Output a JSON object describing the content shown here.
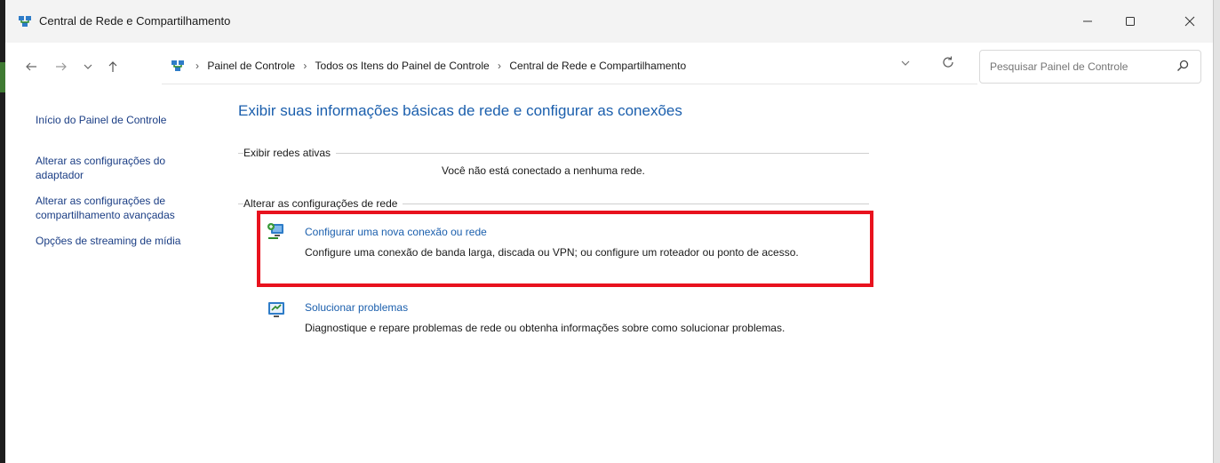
{
  "window": {
    "title": "Central de Rede e Compartilhamento"
  },
  "navigation": {
    "breadcrumbs": [
      "Painel de Controle",
      "Todos os Itens do Painel de Controle",
      "Central de Rede e Compartilhamento"
    ],
    "search_placeholder": "Pesquisar Painel de Controle"
  },
  "sidebar": {
    "items": [
      {
        "label": "Início do Painel de Controle"
      },
      {
        "label": "Alterar as configurações do adaptador"
      },
      {
        "label": "Alterar as configurações de compartilhamento avançadas"
      },
      {
        "label": "Opções de streaming de mídia"
      }
    ]
  },
  "main": {
    "title": "Exibir suas informações básicas de rede e configurar as conexões",
    "active_networks": {
      "label": "Exibir redes ativas",
      "status": "Você não está conectado a nenhuma rede."
    },
    "change_settings": {
      "label": "Alterar as configurações de rede",
      "tasks": [
        {
          "title": "Configurar uma nova conexão ou rede",
          "description": "Configure uma conexão de banda larga, discada ou VPN; ou configure um roteador ou ponto de acesso."
        },
        {
          "title": "Solucionar problemas",
          "description": "Diagnostique e repare problemas de rede ou obtenha informações sobre como solucionar problemas."
        }
      ]
    }
  },
  "colors": {
    "link": "#1b5fad",
    "highlight": "#e8121e",
    "titlebar": "#f3f3f3"
  }
}
